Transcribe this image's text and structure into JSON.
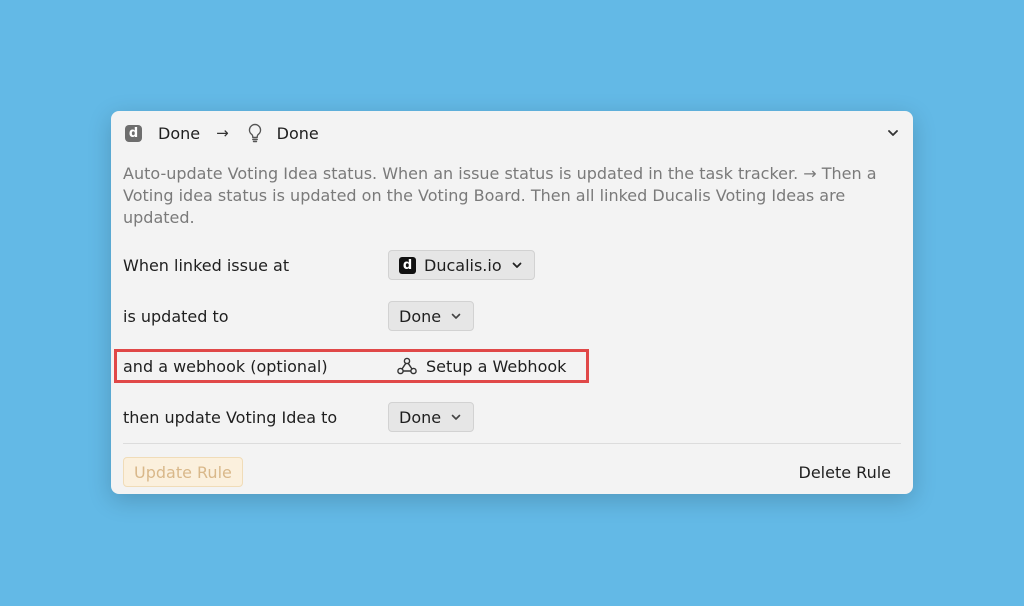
{
  "header": {
    "app_logo_letter": "d",
    "source_status": "Done",
    "arrow": "→",
    "target_status": "Done"
  },
  "description": "Auto-update Voting Idea status. When an issue status is updated in the task tracker. → Then a Voting idea status is updated on the Voting Board. Then all linked Ducalis Voting Ideas are updated.",
  "rows": {
    "linked_issue": {
      "label": "When linked issue at",
      "logo_letter": "d",
      "value": "Ducalis.io"
    },
    "updated_to": {
      "label": "is updated to",
      "value": "Done"
    },
    "webhook": {
      "label": "and a webhook (optional)",
      "link": "Setup a Webhook"
    },
    "voting_idea": {
      "label": "then update Voting Idea to",
      "value": "Done"
    }
  },
  "footer": {
    "update_label": "Update Rule",
    "delete_label": "Delete Rule"
  },
  "colors": {
    "background": "#63b9e6",
    "highlight": "#e04848",
    "update_button_text": "#d9b88a"
  },
  "icons": [
    "ducalis-logo-icon",
    "arrow-right-icon",
    "lightbulb-icon",
    "chevron-down-icon",
    "webhook-icon"
  ]
}
